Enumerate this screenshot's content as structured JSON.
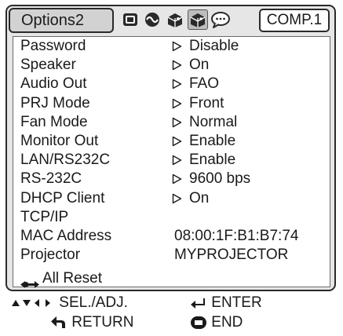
{
  "header": {
    "tab_label": "Options2",
    "comp_label": "COMP.1",
    "icons": [
      "picture-icon",
      "fine-sync-icon",
      "options1-icon",
      "options2-icon",
      "language-icon"
    ]
  },
  "menu": {
    "items": [
      {
        "label": "Password",
        "value": "Disable",
        "arrow": true
      },
      {
        "label": "Speaker",
        "value": "On",
        "arrow": true
      },
      {
        "label": "Audio Out",
        "value": "FAO",
        "arrow": true
      },
      {
        "label": "PRJ Mode",
        "value": "Front",
        "arrow": true
      },
      {
        "label": "Fan Mode",
        "value": "Normal",
        "arrow": true
      },
      {
        "label": "Monitor Out",
        "value": "Enable",
        "arrow": true
      },
      {
        "label": "LAN/RS232C",
        "value": "Enable",
        "arrow": true
      },
      {
        "label": "RS-232C",
        "value": "9600 bps",
        "arrow": true
      },
      {
        "label": "DHCP Client",
        "value": "On",
        "arrow": true
      },
      {
        "label": "TCP/IP",
        "value": "",
        "arrow": false
      },
      {
        "label": "MAC Address",
        "value": "08:00:1F:B1:B7:74",
        "arrow": false
      },
      {
        "label": "Projector",
        "value": "MYPROJECTOR",
        "arrow": false
      }
    ],
    "all_reset": "All Reset"
  },
  "footer": {
    "sel_adj": "SEL./ADJ.",
    "enter": "ENTER",
    "return": "RETURN",
    "end": "END"
  },
  "colors": {
    "frame_bg": "#e6e6e6",
    "panel_bg": "#ffffff",
    "text": "#1a1a1a"
  }
}
